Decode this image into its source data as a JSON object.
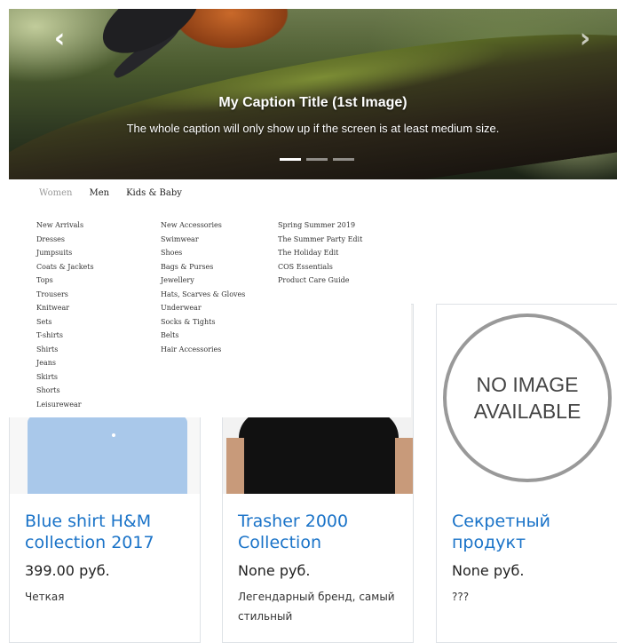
{
  "carousel": {
    "prev_glyph": "‹",
    "next_glyph": "›",
    "caption_title": "My Caption Title (1st Image)",
    "caption_text": "The whole caption will only show up if the screen is at least medium size.",
    "slides_count": 3,
    "active_slide": 1
  },
  "category_nav": {
    "items": [
      "Women",
      "Men",
      "Kids & Baby"
    ]
  },
  "mega_menu": {
    "col1": [
      "New Arrivals",
      "Dresses",
      "Jumpsuits",
      "Coats & Jackets",
      "Tops",
      "Trousers",
      "Knitwear",
      "Sets",
      "T-shirts",
      "Shirts",
      "Jeans",
      "Skirts",
      "Shorts",
      "Leisurewear"
    ],
    "col2": [
      "New Accessories",
      "Swimwear",
      "Shoes",
      "Bags & Purses",
      "Jewellery",
      "Hats, Scarves & Gloves",
      "Underwear",
      "Socks & Tights",
      "Belts",
      "Hair Accessories"
    ],
    "col3": [
      "Spring Summer 2019",
      "The Summer Party Edit",
      "The Holiday Edit",
      "COS Essentials",
      "Product Care Guide"
    ]
  },
  "products": [
    {
      "title": "Blue shirt H&M collection 2017",
      "price": "399.00 руб.",
      "description": "Четкая"
    },
    {
      "title": "Trasher 2000 Collection",
      "price": "None руб.",
      "description": "Легендарный бренд, самый стильный"
    },
    {
      "title": "Секретный продукт",
      "price": "None руб.",
      "description": "???",
      "image_placeholder": "NO IMAGE AVAILABLE"
    }
  ],
  "colors": {
    "link": "#1a73c8"
  }
}
